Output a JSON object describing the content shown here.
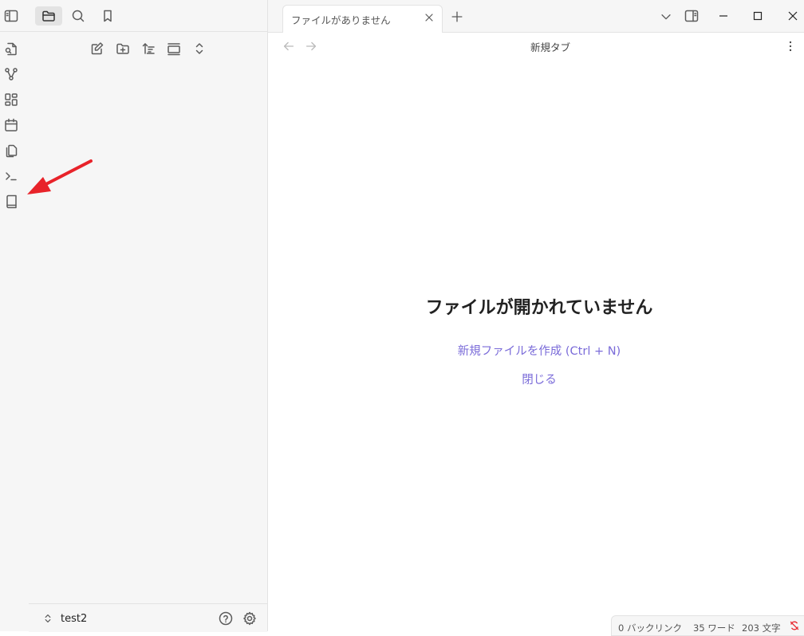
{
  "tab": {
    "title": "ファイルがありません"
  },
  "nav": {
    "title": "新規タブ"
  },
  "empty_state": {
    "title": "ファイルが開かれていません",
    "create_link": "新規ファイルを作成 (Ctrl + N)",
    "close_link": "閉じる"
  },
  "vault": {
    "name": "test2"
  },
  "status": {
    "backlinks": "0 バックリンク",
    "words": "35 ワード",
    "chars": "203 文字"
  },
  "colors": {
    "accent": "#7b6cd9",
    "arrow": "#e8232a"
  }
}
